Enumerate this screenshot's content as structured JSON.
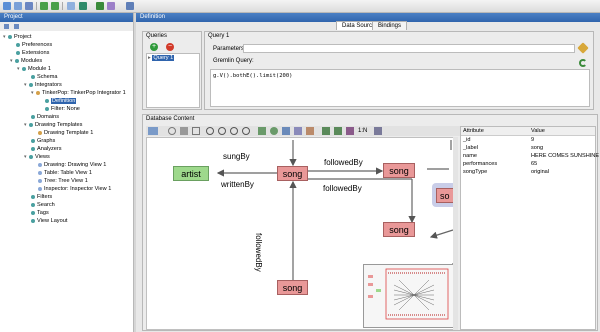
{
  "toolbar": {
    "icons": [
      "open-icon",
      "save-icon",
      "save-all-icon",
      "undo-icon",
      "redo-icon",
      "import-icon",
      "export-icon",
      "refresh-icon",
      "settings-icon",
      "layout-icon"
    ]
  },
  "project_panel": {
    "title": "Project",
    "tree": [
      {
        "label": "Project",
        "depth": 0
      },
      {
        "label": "Preferences",
        "depth": 1
      },
      {
        "label": "Extensions",
        "depth": 1
      },
      {
        "label": "Modules",
        "depth": 1
      },
      {
        "label": "Module 1",
        "depth": 2
      },
      {
        "label": "Schema",
        "depth": 3
      },
      {
        "label": "Integrators",
        "depth": 3
      },
      {
        "label": "TinkerPop: TinkerPop Integrator 1",
        "depth": 4
      },
      {
        "label": "Definition",
        "depth": 5,
        "selected": true
      },
      {
        "label": "Filter: None",
        "depth": 5
      },
      {
        "label": "Domains",
        "depth": 3
      },
      {
        "label": "Drawing Templates",
        "depth": 3
      },
      {
        "label": "Drawing Template 1",
        "depth": 4
      },
      {
        "label": "Graphs",
        "depth": 3
      },
      {
        "label": "Analyzers",
        "depth": 3
      },
      {
        "label": "Views",
        "depth": 3
      },
      {
        "label": "Drawing: Drawing View 1",
        "depth": 4
      },
      {
        "label": "Table: Table View 1",
        "depth": 4
      },
      {
        "label": "Tree: Tree View 1",
        "depth": 4
      },
      {
        "label": "Inspector: Inspector View 1",
        "depth": 4
      },
      {
        "label": "Filters",
        "depth": 3
      },
      {
        "label": "Search",
        "depth": 3
      },
      {
        "label": "Tags",
        "depth": 3
      },
      {
        "label": "View Layout",
        "depth": 3
      }
    ]
  },
  "definition_panel": {
    "title": "Definition",
    "tabs": [
      "Data Source",
      "Bindings"
    ],
    "queries_label": "Queries",
    "query_list": [
      "Query 1"
    ],
    "query_title": "Query 1",
    "parameters_label": "Parameters:",
    "gremlin_label": "Gremlin Query:",
    "gremlin_query": "g.V().bothE().limit(200)"
  },
  "database_content": {
    "title": "Database Content",
    "zoom_label": "1:N",
    "nodes": [
      "artist",
      "song",
      "song",
      "song",
      "song",
      "song"
    ],
    "edge_labels": [
      "sungBy",
      "writtenBy",
      "followedBy",
      "followedBy",
      "followedBy"
    ],
    "partial_node_label": "so",
    "properties": {
      "headers": [
        "Attribute",
        "Value"
      ],
      "rows": [
        [
          "_id",
          "9"
        ],
        [
          "_label",
          "song"
        ],
        [
          "name",
          "HERE COMES SUNSHINE"
        ],
        [
          "performances",
          "65"
        ],
        [
          "songType",
          "original"
        ]
      ]
    }
  },
  "colors": {
    "header_blue": "#2f64ad",
    "song_node": "#e99898",
    "artist_node": "#9ed98c"
  }
}
